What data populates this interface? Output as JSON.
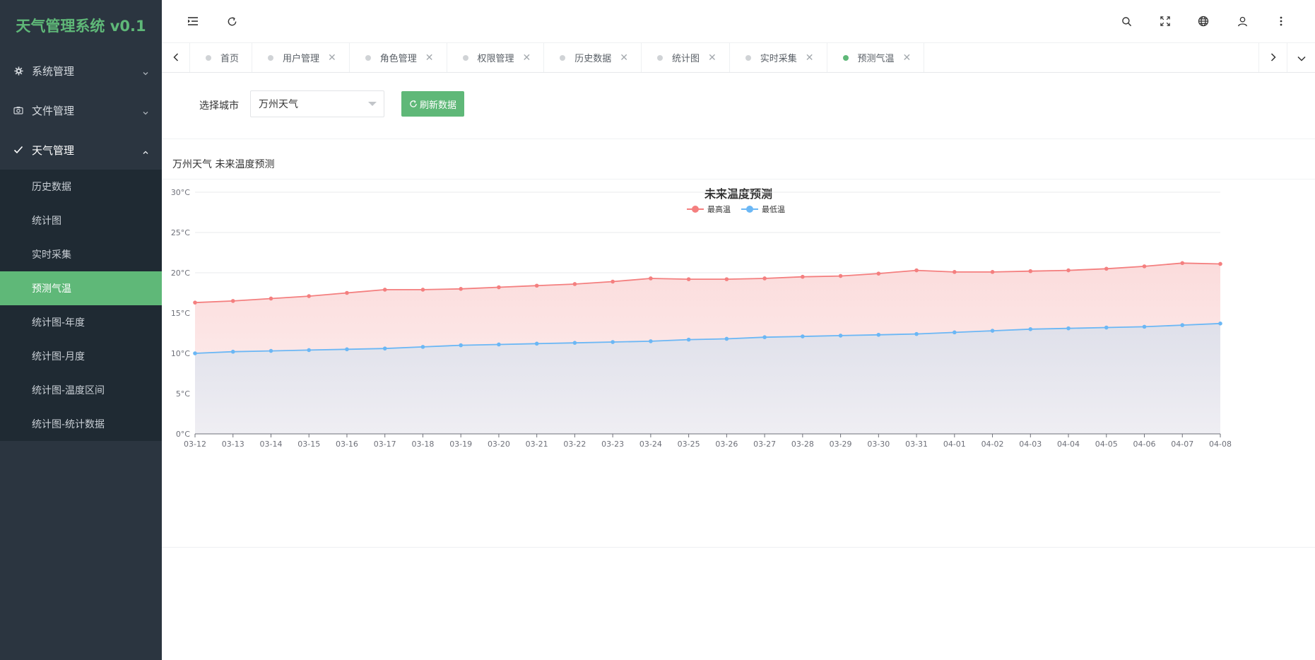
{
  "app": {
    "title": "天气管理系统 v0.1"
  },
  "sidebar": {
    "menus": [
      {
        "label": "系统管理",
        "icon": "gear-icon"
      },
      {
        "label": "文件管理",
        "icon": "camera-icon"
      },
      {
        "label": "天气管理",
        "icon": "check-icon"
      }
    ],
    "submenu": [
      {
        "label": "历史数据"
      },
      {
        "label": "统计图"
      },
      {
        "label": "实时采集"
      },
      {
        "label": "预测气温",
        "active": true
      },
      {
        "label": "统计图-年度"
      },
      {
        "label": "统计图-月度"
      },
      {
        "label": "统计图-温度区间"
      },
      {
        "label": "统计图-统计数据"
      }
    ]
  },
  "header": {
    "icons": [
      "menu-toggle-icon",
      "refresh-icon",
      "search-icon",
      "fullscreen-icon",
      "globe-icon",
      "user-icon",
      "more-icon"
    ]
  },
  "tabs": [
    {
      "label": "首页",
      "closable": false
    },
    {
      "label": "用户管理",
      "closable": true
    },
    {
      "label": "角色管理",
      "closable": true
    },
    {
      "label": "权限管理",
      "closable": true
    },
    {
      "label": "历史数据",
      "closable": true
    },
    {
      "label": "统计图",
      "closable": true
    },
    {
      "label": "实时采集",
      "closable": true
    },
    {
      "label": "预测气温",
      "closable": true,
      "active": true
    }
  ],
  "filter": {
    "label": "选择城市",
    "selected_city": "万州天气",
    "refresh_label": "刷新数据"
  },
  "card": {
    "title": "万州天气 未来温度预测"
  },
  "colors": {
    "accent": "#5fb878",
    "max_series": "#f47f7f",
    "min_series": "#6bb7f5"
  },
  "chart_data": {
    "type": "line",
    "title": "未来温度预测",
    "x": [
      "03-12",
      "03-13",
      "03-14",
      "03-15",
      "03-16",
      "03-17",
      "03-18",
      "03-19",
      "03-20",
      "03-21",
      "03-22",
      "03-23",
      "03-24",
      "03-25",
      "03-26",
      "03-27",
      "03-28",
      "03-29",
      "03-30",
      "03-31",
      "04-01",
      "04-02",
      "04-03",
      "04-04",
      "04-05",
      "04-06",
      "04-07",
      "04-08"
    ],
    "y_ticks": [
      "0°C",
      "5°C",
      "10°C",
      "15°C",
      "20°C",
      "25°C",
      "30°C"
    ],
    "ylim": [
      0,
      30
    ],
    "legend_position": "top-center",
    "grid": true,
    "series": [
      {
        "name": "最高温",
        "color": "#f47f7f",
        "values": [
          16.3,
          16.5,
          16.8,
          17.1,
          17.5,
          17.9,
          17.9,
          18.0,
          18.2,
          18.4,
          18.6,
          18.9,
          19.3,
          19.2,
          19.2,
          19.3,
          19.5,
          19.6,
          19.9,
          20.3,
          20.1,
          20.1,
          20.2,
          20.3,
          20.5,
          20.8,
          21.2,
          21.1
        ]
      },
      {
        "name": "最低温",
        "color": "#6bb7f5",
        "values": [
          10.0,
          10.2,
          10.3,
          10.4,
          10.5,
          10.6,
          10.8,
          11.0,
          11.1,
          11.2,
          11.3,
          11.4,
          11.5,
          11.7,
          11.8,
          12.0,
          12.1,
          12.2,
          12.3,
          12.4,
          12.6,
          12.8,
          13.0,
          13.1,
          13.2,
          13.3,
          13.5,
          13.7
        ]
      }
    ]
  }
}
